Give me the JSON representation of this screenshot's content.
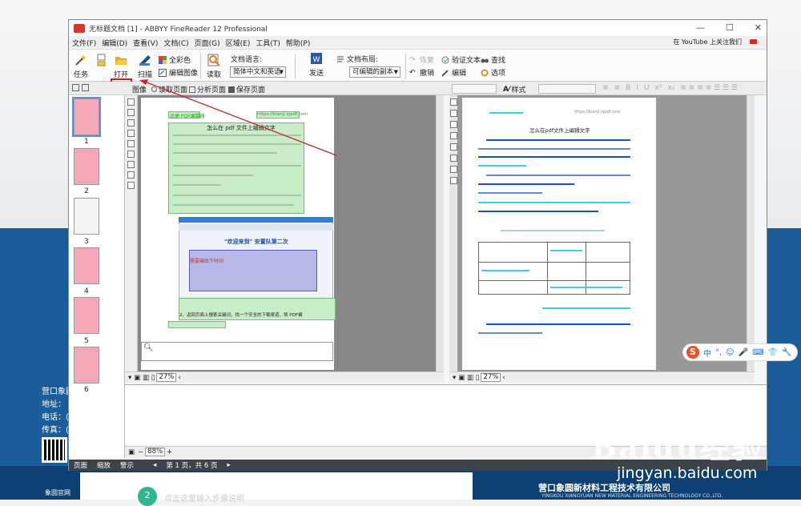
{
  "desktop": {
    "company_lines": [
      "营口象圆",
      "地址：",
      "电话：(",
      "传真：("
    ],
    "qr_label": "象圆官网",
    "step_number": "2",
    "step_hint": "点击这里输入步骤说明",
    "company_name": "营口象圆新材料工程技术有限公司",
    "company_name_en": "YINGKOU XIANGYUAN NEW MATERIAL ENGINEERING TECHNOLOGY CO.,LTD.",
    "watermark": "Baidu经验",
    "watermark_sub": "jingyan.baidu.com"
  },
  "window": {
    "title": "无标题文档 [1] - ABBYY FineReader 12 Professional",
    "controls": [
      "—",
      "☐",
      "✕"
    ]
  },
  "menu": {
    "items": [
      "文件(F)",
      "编辑(D)",
      "查看(V)",
      "文档(C)",
      "页面(G)",
      "区域(E)",
      "工具(T)",
      "帮助(P)"
    ],
    "right_text": "在 YouTube 上关注我们"
  },
  "ribbon": {
    "task": "任务",
    "open": "打开",
    "scan": "扫描",
    "full_color": "全彩色",
    "edit_image": "编辑图像",
    "read": "读取",
    "doc_lang_label": "文档语言:",
    "doc_lang_value": "简体中文和英语",
    "send": "发送",
    "doc_layout_label": "文档布局:",
    "doc_layout_value": "可编辑的副本",
    "restore": "恢复",
    "undo": "撤销",
    "verify_text": "验证文本",
    "edit": "编辑",
    "find": "查找",
    "options": "选项"
  },
  "toolbar2": {
    "image_label": "图像",
    "read_page": "读取页面",
    "analyze_page": "分析页面",
    "save_page": "保存页面",
    "style_label": "样式",
    "fmt": [
      "B",
      "I",
      "U",
      "x²",
      "x₂"
    ]
  },
  "thumbnails": [
    {
      "num": "1",
      "selected": true,
      "style": "pink"
    },
    {
      "num": "2",
      "selected": false,
      "style": "pink"
    },
    {
      "num": "3",
      "selected": false,
      "style": "plain"
    },
    {
      "num": "4",
      "selected": false,
      "style": "pink"
    },
    {
      "num": "5",
      "selected": false,
      "style": "pink"
    },
    {
      "num": "6",
      "selected": false,
      "style": "pink"
    }
  ],
  "image_page": {
    "header_left": "迅捷 PDF编辑器",
    "header_right": "https://bianji.xjpdf.com",
    "heading": "怎么在 pdf 文件上编辑文字",
    "table_title": "\"欢迎来到\" 安置队第二次",
    "red_text": "需要编改下时间",
    "step2": "2、返回页面上搜索关键词，找一个安全的下载渠道，将    PDF编"
  },
  "text_page": {
    "heading": "怎么在pdf文件上编辑文字",
    "link": "https://bianji.xjpdf.com"
  },
  "status_mini": {
    "left_zoom": "27%",
    "right_zoom": "27%",
    "bottom_zoom": "88%"
  },
  "statusbar": {
    "tabs": [
      "页面",
      "缩放",
      "警示"
    ],
    "page_info": "第 1 页，共 6 页"
  },
  "sogou": {
    "items": [
      "中",
      "°,",
      "☺",
      "🎤",
      "⌨",
      "👕",
      "🔧"
    ]
  }
}
